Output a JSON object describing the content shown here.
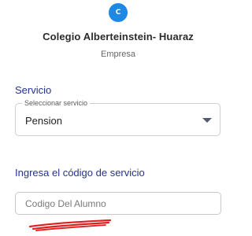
{
  "header": {
    "logo_letter": "C",
    "company_name": "Colegio Alberteinstein- Huaraz",
    "company_type": "Empresa"
  },
  "service": {
    "section_label": "Servicio",
    "dropdown_legend": "Seleccionar servicio",
    "selected_value": "Pension"
  },
  "code": {
    "section_label": "Ingresa el código de servicio",
    "placeholder": "Codigo Del Alumno"
  },
  "colors": {
    "accent": "#1e88e5",
    "section_label": "#24328f",
    "annotation": "#e02020"
  }
}
